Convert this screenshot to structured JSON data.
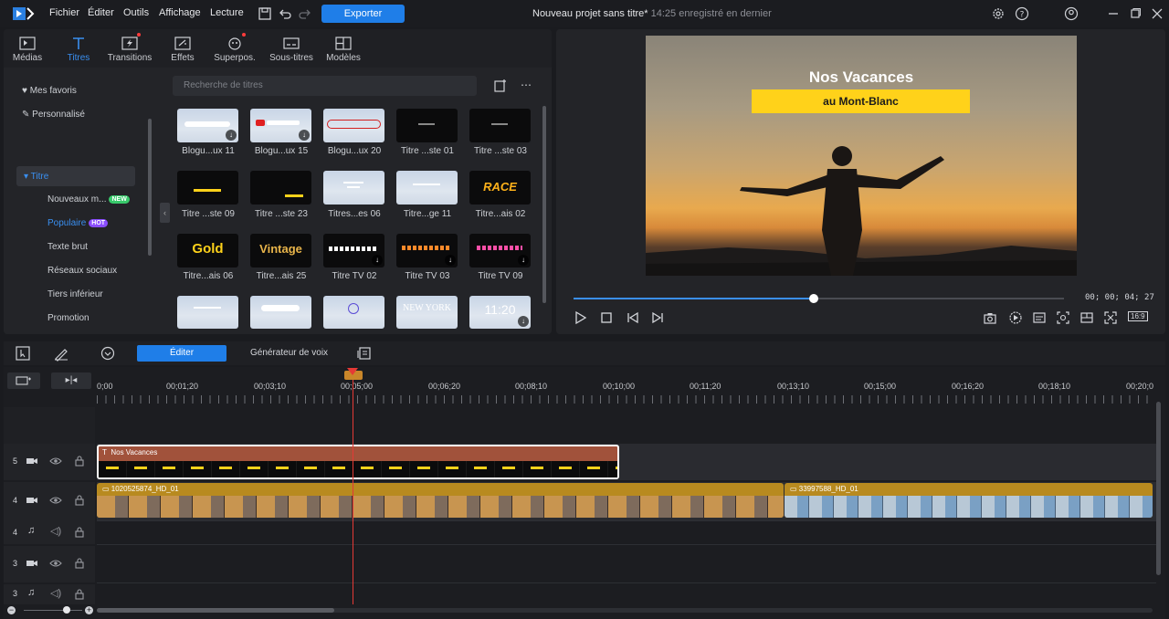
{
  "menu": [
    "Fichier",
    "Éditer",
    "Outils",
    "Affichage",
    "Lecture"
  ],
  "export_label": "Exporter",
  "project": {
    "title": "Nouveau projet sans titre*",
    "saved": "14:25 enregistré en dernier"
  },
  "library_tabs": [
    {
      "label": "Médias",
      "icon": "media-icon"
    },
    {
      "label": "Titres",
      "icon": "titles-icon"
    },
    {
      "label": "Transitions",
      "icon": "transitions-icon"
    },
    {
      "label": "Effets",
      "icon": "effects-icon"
    },
    {
      "label": "Superpos.",
      "icon": "overlay-icon"
    },
    {
      "label": "Sous-titres",
      "icon": "subtitles-icon"
    },
    {
      "label": "Modèles",
      "icon": "templates-icon"
    }
  ],
  "sidebar": {
    "favorites": "Mes favoris",
    "custom": "Personnalisé",
    "title_group": "Titre",
    "items": [
      "Nouveaux m...",
      "Populaire",
      "Texte brut",
      "Réseaux sociaux",
      "Tiers inférieur",
      "Promotion"
    ],
    "new_badge": "NEW",
    "hot_badge": "HOT"
  },
  "search_placeholder": "Recherche de titres",
  "thumb_texts": {
    "race": "RACE",
    "gold": "Gold",
    "vintage": "Vintage",
    "newyork": "NEW YORK",
    "clock": "11:20"
  },
  "thumbnails": [
    "Blogu...ux 11",
    "Blogu...ux 15",
    "Blogu...ux 20",
    "Titre ...ste 01",
    "Titre ...ste 03",
    "Titre ...ste 09",
    "Titre ...ste 23",
    "Titres...es 06",
    "Titre...ge 11",
    "Titre...ais 02",
    "Titre...ais 06",
    "Titre...ais 25",
    "Titre TV 02",
    "Titre TV 03",
    "Titre TV 09"
  ],
  "preview": {
    "title": "Nos Vacances",
    "subtitle": "au Mont-Blanc",
    "timecode": "00; 00; 04; 27",
    "aspect": "16:9",
    "progress": 0.49
  },
  "edit_toolbar": {
    "edit_label": "Éditer",
    "voice_label": "Générateur de voix"
  },
  "ruler_labels": [
    "0;00",
    "00;01;20",
    "00;03;10",
    "00;05;00",
    "00;06;20",
    "00;08;10",
    "00;10;00",
    "00;11;20",
    "00;13;10",
    "00;15;00",
    "00;16;20",
    "00;18;10",
    "00;20;0"
  ],
  "tracks": [
    {
      "num": "5",
      "type": "video"
    },
    {
      "num": "4",
      "type": "video"
    },
    {
      "num": "4",
      "type": "audio"
    },
    {
      "num": "3",
      "type": "video"
    },
    {
      "num": "3",
      "type": "audio"
    }
  ],
  "clips": {
    "title_clip": "Nos Vacances",
    "video1": "1020525874_HD_01",
    "video2": "33997588_HD_01"
  },
  "colors": {
    "accent": "#1f7ee8",
    "playhead": "#e53935",
    "title_clip": "#a1523b",
    "video_clip": "#b88a1f"
  }
}
